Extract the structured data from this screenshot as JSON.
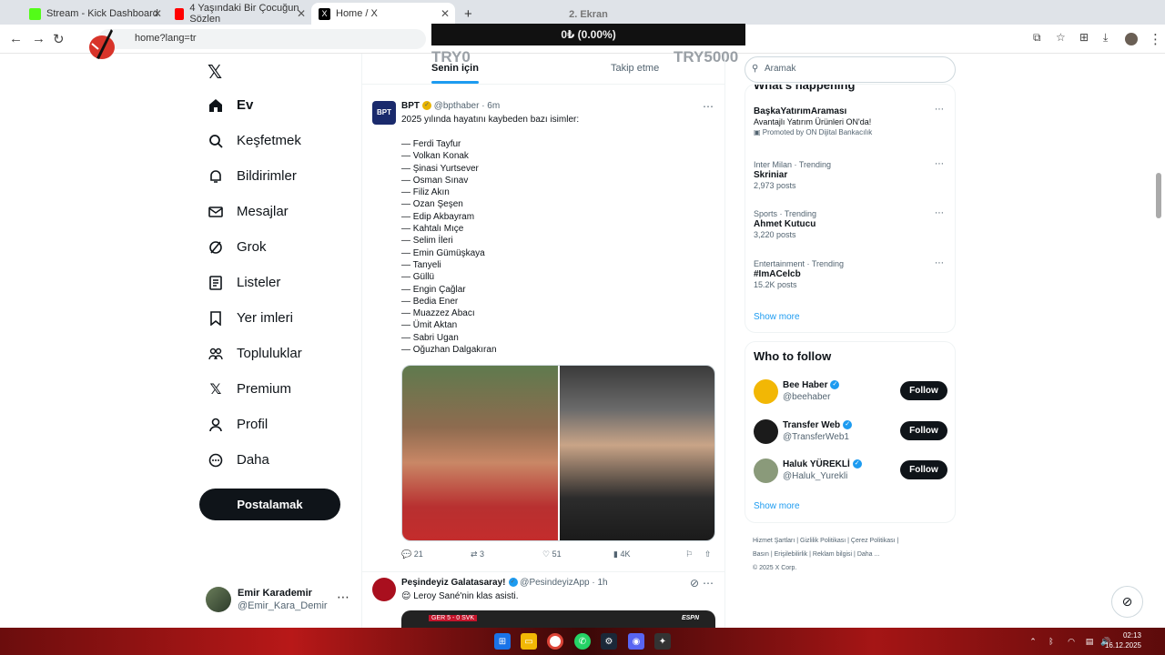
{
  "browser": {
    "tabs": [
      {
        "title": "Stream - Kick Dashboard",
        "color": "#53fc18"
      },
      {
        "title": "4 Yaşındaki Bir Çocuğun Sözlen",
        "color": "#ff0000"
      },
      {
        "title": "Home / X",
        "color": "#000000"
      }
    ],
    "new_tab": "+",
    "url": "home?lang=tr"
  },
  "overlay": {
    "top_label": "2. Ekran",
    "value": "0₺ (0.00%)",
    "left_label": "TRY0",
    "right_label": "TRY5000"
  },
  "nav": {
    "items": [
      {
        "label": "Ev",
        "icon": "home-icon"
      },
      {
        "label": "Keşfetmek",
        "icon": "search-icon"
      },
      {
        "label": "Bildirimler",
        "icon": "bell-icon"
      },
      {
        "label": "Mesajlar",
        "icon": "mail-icon"
      },
      {
        "label": "Grok",
        "icon": "grok-icon"
      },
      {
        "label": "Listeler",
        "icon": "list-icon"
      },
      {
        "label": "Yer imleri",
        "icon": "bookmark-icon"
      },
      {
        "label": "Topluluklar",
        "icon": "people-icon"
      },
      {
        "label": "Premium",
        "icon": "x-icon"
      },
      {
        "label": "Profil",
        "icon": "person-icon"
      },
      {
        "label": "Daha",
        "icon": "more-circle-icon"
      }
    ],
    "post_button": "Postalamak",
    "profile": {
      "name": "Emir Karademir",
      "handle": "@Emir_Kara_Demir"
    }
  },
  "feed": {
    "tabs": [
      "Senin için",
      "Takip etme"
    ],
    "tweet1": {
      "name": "BPT",
      "handle": "@bpthaber",
      "time": "· 6m",
      "intro": "2025 yılında hayatını kaybeden bazı isimler:",
      "names": [
        "— Ferdi Tayfur",
        "— Volkan Konak",
        "— Şinasi Yurtsever",
        "— Osman Sınav",
        "— Filiz Akın",
        "— Ozan Şeşen",
        "— Edip Akbayram",
        "— Kahtalı Mıçe",
        "— Selim İleri",
        "— Emin Gümüşkaya",
        "— Tanyeli",
        "— Güllü",
        "— Engin Çağlar",
        "— Bedia Ener",
        "— Muazzez Abacı",
        "— Ümit Aktan",
        "— Sabri Ugan",
        "— Oğuzhan Dalgakıran"
      ],
      "replies": "21",
      "reposts": "3",
      "likes": "51",
      "views": "4K"
    },
    "tweet2": {
      "name": "Peşindeyiz Galatasaray!",
      "handle": "@PesindeyizApp",
      "time": "· 1h",
      "text": "😌 Leroy Sané'nin klas asisti.",
      "media_label": "ESPN",
      "score": "GER  5 - 0  SVK"
    }
  },
  "sidebar": {
    "search_placeholder": "Aramak",
    "happening_title": "What's happening",
    "trends": [
      {
        "meta": "",
        "title": "BaşkaYatırımAraması",
        "sub": "Avantajlı Yatırım Ürünleri ON'da!",
        "promo": "Promoted by ON Dijital Bankacılık"
      },
      {
        "meta": "Inter Milan · Trending",
        "title": "Skriniar",
        "sub": "2,973 posts"
      },
      {
        "meta": "Sports · Trending",
        "title": "Ahmet Kutucu",
        "sub": "3,220 posts"
      },
      {
        "meta": "Entertainment · Trending",
        "title": "#ImACelcb",
        "sub": "15.2K posts"
      }
    ],
    "show_more": "Show more",
    "who_to_follow": "Who to follow",
    "follow": [
      {
        "name": "Bee Haber",
        "handle": "@beehaber",
        "button": "Follow"
      },
      {
        "name": "Transfer Web",
        "handle": "@TransferWeb1",
        "button": "Follow"
      },
      {
        "name": "Haluk YÜREKLİ",
        "handle": "@Haluk_Yurekli",
        "button": "Follow"
      }
    ],
    "show_more_2": "Show more",
    "footer": [
      "Hizmet Şartları",
      "Gizlilik Politikası",
      "Çerez Politikası",
      "Basın",
      "Erişilebilirlik",
      "Reklam bilgisi",
      "Daha ...",
      "© 2025 X Corp."
    ]
  },
  "taskbar": {
    "time": "02:13",
    "date": "16.12.2025"
  }
}
